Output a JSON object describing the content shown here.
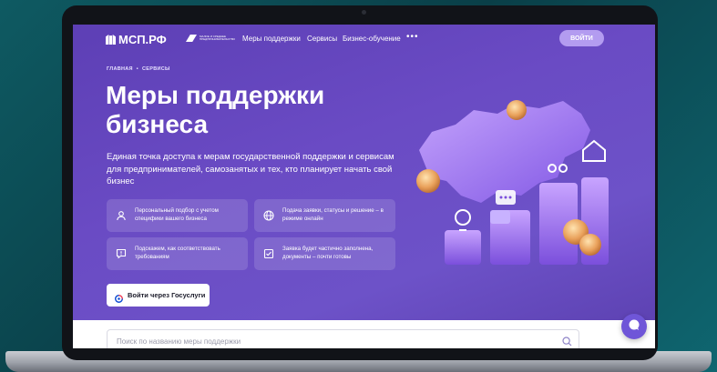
{
  "header": {
    "logo_text": "МСП.РФ",
    "partner_text": "МАЛОЕ И СРЕДНЕЕ ПРЕДПРИНИМАТЕЛЬСТВО",
    "nav": [
      "Меры поддержки",
      "Сервисы",
      "Бизнес-обучение"
    ],
    "more": "•••",
    "login_label": "ВОЙТИ"
  },
  "breadcrumbs": [
    "ГЛАВНАЯ",
    "•",
    "СЕРВИСЫ"
  ],
  "hero": {
    "title": "Меры поддержки бизнеса",
    "lead": "Единая точка доступа к мерам государственной поддержки и сервисам для предпринимателей, самозанятых и тех, кто планирует начать свой бизнес"
  },
  "features": [
    {
      "icon": "person-icon",
      "text": "Персональный подбор с учетом специфики вашего бизнеса"
    },
    {
      "icon": "globe-icon",
      "text": "Подача заявки, статусы и решение – в режиме онлайн"
    },
    {
      "icon": "message-alert-icon",
      "text": "Подскажем, как соответствовать требованиям"
    },
    {
      "icon": "form-check-icon",
      "text": "Заявка будет частично заполнена, документы – почти готовы"
    }
  ],
  "gosuslugi_label": "Войти через Госуслуги",
  "search": {
    "placeholder": "Поиск по названию меры поддержки"
  },
  "colors": {
    "hero_bg": "#6a4bc4",
    "accent": "#b39cf0",
    "chat": "#6f56d8"
  }
}
